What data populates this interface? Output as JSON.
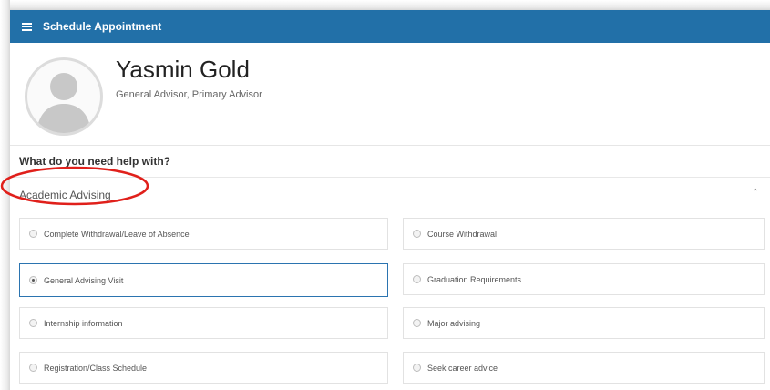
{
  "header": {
    "title": "Schedule Appointment",
    "menu_icon": "hamburger-menu-icon"
  },
  "advisor": {
    "name": "Yasmin Gold",
    "role": "General Advisor, Primary Advisor",
    "avatar_icon": "user-avatar-icon"
  },
  "prompt": "What do you need help with?",
  "section": {
    "title": "Academic Advising",
    "collapse_icon": "chevron-up-icon",
    "highlight_color": "#e0201b"
  },
  "options": [
    {
      "label": "Complete Withdrawal/Leave of Absence",
      "selected": false
    },
    {
      "label": "Course Withdrawal",
      "selected": false
    },
    {
      "label": "General Advising Visit",
      "selected": true
    },
    {
      "label": "Graduation Requirements",
      "selected": false
    },
    {
      "label": "Internship information",
      "selected": false
    },
    {
      "label": "Major advising",
      "selected": false
    },
    {
      "label": "Registration/Class Schedule",
      "selected": false
    },
    {
      "label": "Seek career advice",
      "selected": false
    }
  ],
  "colors": {
    "header_bg": "#2270a8",
    "selected_border": "#2b74b0"
  }
}
